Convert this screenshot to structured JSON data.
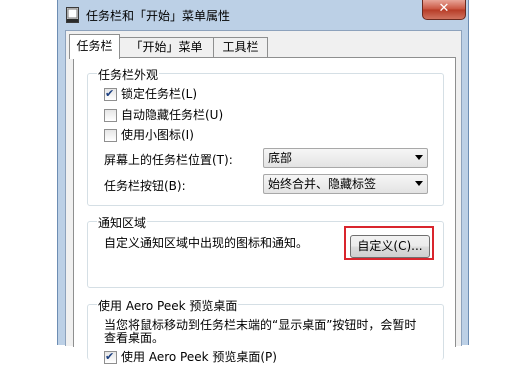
{
  "window": {
    "title": "任务栏和「开始」菜单属性",
    "close_glyph": "✕"
  },
  "tabs": [
    {
      "label": "任务栏",
      "active": true
    },
    {
      "label": "「开始」菜单",
      "active": false
    },
    {
      "label": "工具栏",
      "active": false
    }
  ],
  "appearance": {
    "legend": "任务栏外观",
    "checkboxes": [
      {
        "label": "锁定任务栏(L)",
        "checked": true
      },
      {
        "label": "自动隐藏任务栏(U)",
        "checked": false
      },
      {
        "label": "使用小图标(I)",
        "checked": false
      }
    ],
    "position_label": "屏幕上的任务栏位置(T):",
    "position_value": "底部",
    "buttons_label": "任务栏按钮(B):",
    "buttons_value": "始终合并、隐藏标签"
  },
  "notification": {
    "legend": "通知区域",
    "description": "自定义通知区域中出现的图标和通知。",
    "customize_label": "自定义(C)..."
  },
  "aero_peek": {
    "legend": "使用 Aero Peek 预览桌面",
    "description_line1": "当您将鼠标移动到任务栏末端的“显示桌面”按钮时，会暂时",
    "description_line2": "查看桌面。",
    "checkbox_label": "使用 Aero Peek 预览桌面(P)",
    "checkbox_checked": true
  },
  "colors": {
    "highlight": "#d9252d",
    "window_frame": "#bcd0e6",
    "close_button": "#c8523d"
  }
}
